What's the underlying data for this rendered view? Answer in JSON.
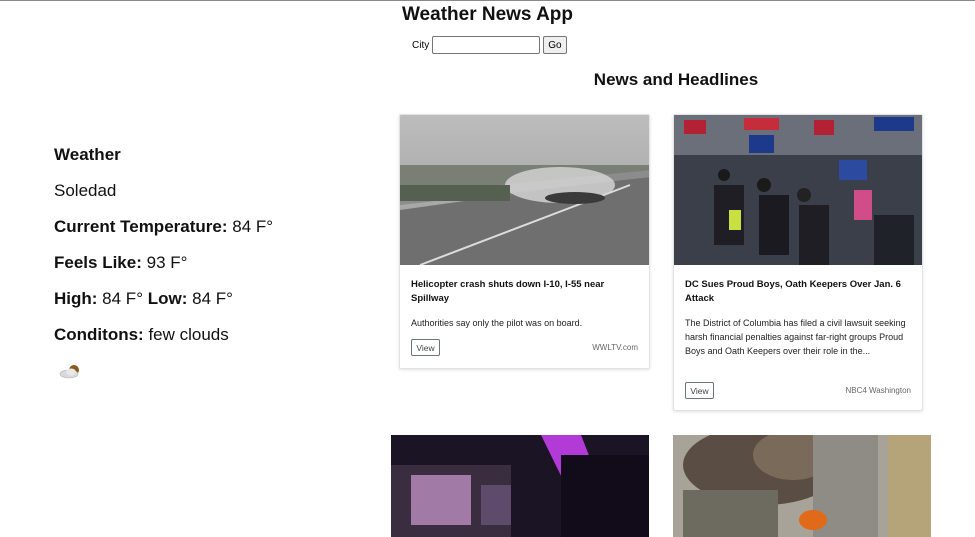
{
  "app": {
    "title": "Weather News App"
  },
  "search": {
    "label": "City",
    "value": "",
    "placeholder": "",
    "button_label": "Go"
  },
  "weather": {
    "heading": "Weather",
    "city": "Soledad",
    "current_label": "Current Temperature:",
    "current_value": "84 F°",
    "feels_label": "Feels Like:",
    "feels_value": "93 F°",
    "high_label": "High:",
    "high_value": "84 F°",
    "low_label": "Low:",
    "low_value": "84 F°",
    "conditions_label": "Conditons:",
    "conditions_value": "few clouds",
    "icon": "few-clouds-day-icon"
  },
  "news": {
    "heading": "News and Headlines",
    "articles": [
      {
        "headline": "Helicopter crash shuts down I-10, I-55 near Spillway",
        "description": "Authorities say only the pilot was on board.",
        "view_label": "View",
        "source": "WWLTV.com",
        "image": "helicopter-crash-highway-image"
      },
      {
        "headline": "DC Sues Proud Boys, Oath Keepers Over Jan. 6 Attack",
        "description": "The District of Columbia has filed a civil lawsuit seeking harsh financial penalties against far-right groups Proud Boys and Oath Keepers over their role in the...",
        "view_label": "View",
        "source": "NBC4 Washington",
        "image": "crowd-protest-image"
      },
      {
        "image": "night-street-lights-image"
      },
      {
        "image": "building-fire-smoke-image"
      }
    ]
  }
}
